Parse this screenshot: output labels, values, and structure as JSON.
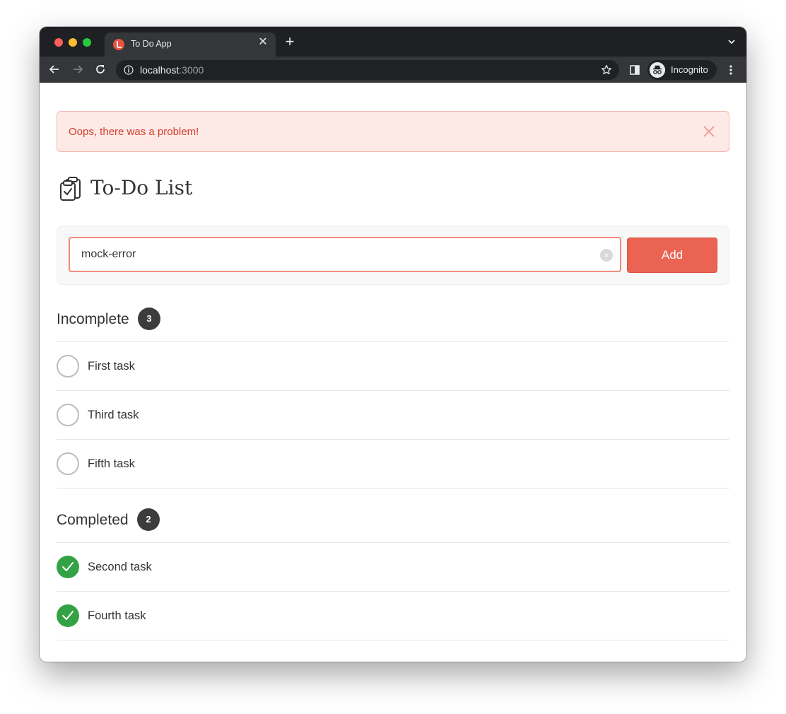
{
  "browser": {
    "tab_title": "To Do App",
    "tab_close": "✕",
    "new_tab": "+",
    "url_host": "localhost",
    "url_port": ":3000",
    "profile_label": "Incognito"
  },
  "alert": {
    "message": "Oops, there was a problem!"
  },
  "header": {
    "title": "To-Do List"
  },
  "form": {
    "input_value": "mock-error",
    "clear_glyph": "×",
    "add_label": "Add"
  },
  "incomplete": {
    "title": "Incomplete",
    "count": "3",
    "tasks": [
      {
        "label": "First task"
      },
      {
        "label": "Third task"
      },
      {
        "label": "Fifth task"
      }
    ]
  },
  "completed": {
    "title": "Completed",
    "count": "2",
    "tasks": [
      {
        "label": "Second task"
      },
      {
        "label": "Fourth task"
      }
    ]
  },
  "colors": {
    "accent": "#ea6353",
    "alert_bg": "#fde9e6",
    "alert_text": "#d63f2b",
    "done_green": "#34a145",
    "badge": "#3c3c3c"
  }
}
